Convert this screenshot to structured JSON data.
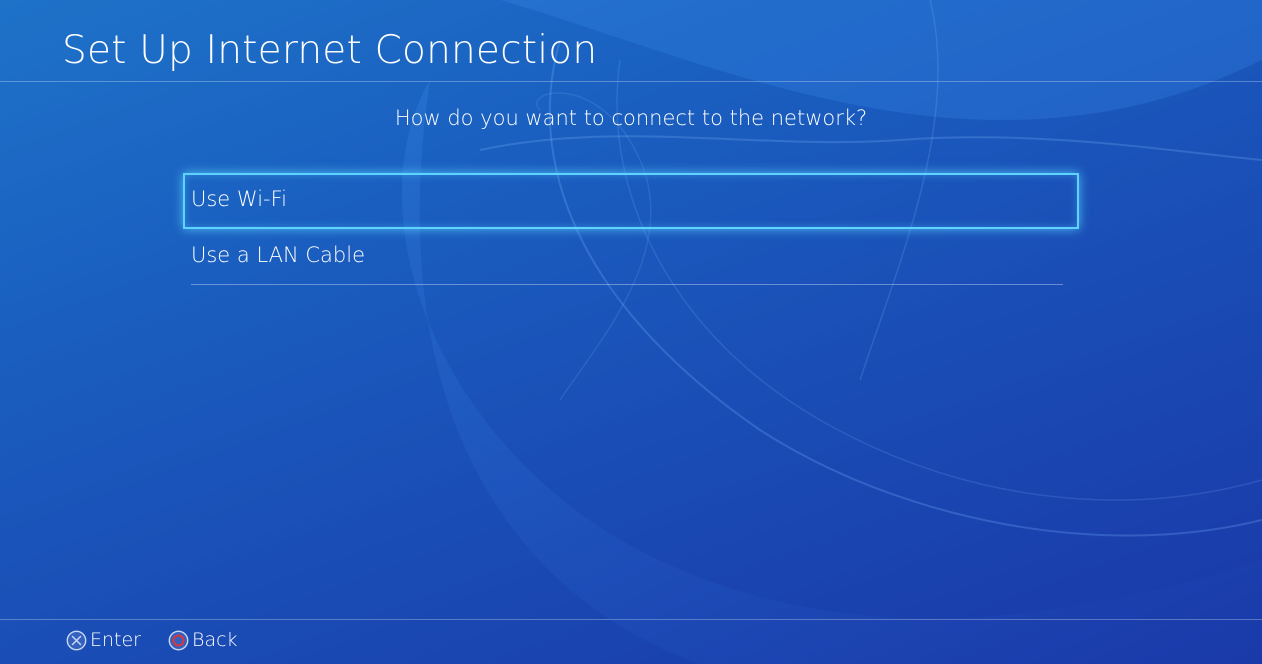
{
  "header": {
    "title": "Set Up Internet Connection"
  },
  "main": {
    "prompt": "How do you want to connect to the network?",
    "options": [
      {
        "label": "Use Wi-Fi",
        "selected": true
      },
      {
        "label": "Use a LAN Cable",
        "selected": false
      }
    ]
  },
  "footer": {
    "enter": {
      "icon": "cross-button-icon",
      "label": "Enter"
    },
    "back": {
      "icon": "circle-button-icon",
      "label": "Back"
    }
  },
  "colors": {
    "focus_border": "#5fd3ff",
    "circle_button": "#e0343a",
    "background_top": "#1e72c8",
    "background_bottom": "#1a38a8"
  }
}
